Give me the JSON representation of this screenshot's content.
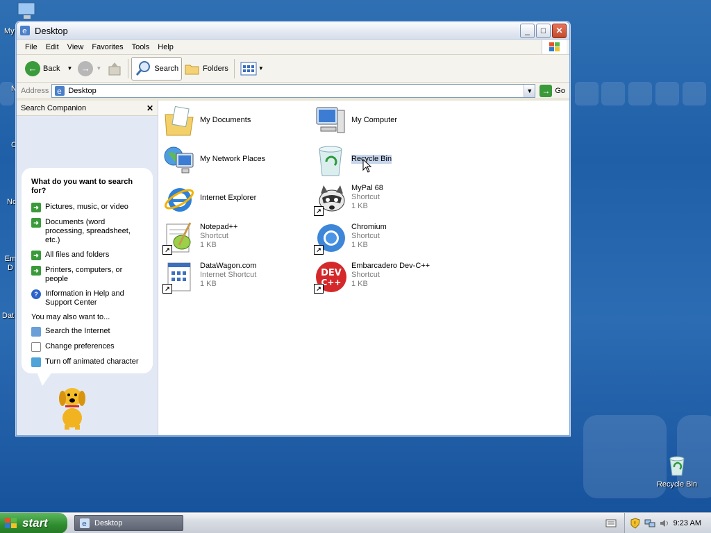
{
  "desktop": {
    "recycle_label": "Recycle Bin",
    "left_labels": [
      "My",
      "N",
      "C",
      "No",
      "Em D",
      "Dat"
    ]
  },
  "window": {
    "title": "Desktop",
    "controls": {
      "minimize": "_",
      "maximize": "□",
      "close": "✕"
    }
  },
  "menubar": {
    "items": [
      "File",
      "Edit",
      "View",
      "Favorites",
      "Tools",
      "Help"
    ]
  },
  "toolbar": {
    "back_label": "Back",
    "search_label": "Search",
    "folders_label": "Folders"
  },
  "address": {
    "label": "Address",
    "value": "Desktop",
    "go_label": "Go"
  },
  "sidebar": {
    "title": "Search Companion",
    "heading": "What do you want to search for?",
    "options": [
      {
        "label": "Pictures, music, or video"
      },
      {
        "label": "Documents (word processing, spreadsheet, etc.)"
      },
      {
        "label": "All files and folders"
      },
      {
        "label": "Printers, computers, or people"
      },
      {
        "label": "Information in Help and Support Center"
      }
    ],
    "also_text": "You may also want to...",
    "extra": [
      {
        "label": "Search the Internet"
      },
      {
        "label": "Change preferences"
      },
      {
        "label": "Turn off animated character"
      }
    ]
  },
  "files": [
    {
      "name": "My Documents",
      "sub1": "",
      "sub2": "",
      "icon": "folder-documents-icon"
    },
    {
      "name": "My Computer",
      "sub1": "",
      "sub2": "",
      "icon": "computer-icon"
    },
    {
      "name": "My Network Places",
      "sub1": "",
      "sub2": "",
      "icon": "network-icon"
    },
    {
      "name": "Recycle Bin",
      "sub1": "",
      "sub2": "",
      "icon": "recycle-bin-icon"
    },
    {
      "name": "Internet Explorer",
      "sub1": "",
      "sub2": "",
      "icon": "ie-icon"
    },
    {
      "name": "MyPal 68",
      "sub1": "Shortcut",
      "sub2": "1 KB",
      "icon": "raccoon-icon"
    },
    {
      "name": "Notepad++",
      "sub1": "Shortcut",
      "sub2": "1 KB",
      "icon": "notepad-icon"
    },
    {
      "name": "Chromium",
      "sub1": "Shortcut",
      "sub2": "1 KB",
      "icon": "chromium-icon"
    },
    {
      "name": "DataWagon.com",
      "sub1": "Internet Shortcut",
      "sub2": "1 KB",
      "icon": "url-icon"
    },
    {
      "name": "Embarcadero Dev-C++",
      "sub1": "Shortcut",
      "sub2": "1 KB",
      "icon": "devcpp-icon"
    }
  ],
  "devcpp_logo": {
    "top": "DEV",
    "bottom": "C++"
  },
  "taskbar": {
    "start_label": "start",
    "task_label": "Desktop",
    "clock": "9:23 AM"
  }
}
